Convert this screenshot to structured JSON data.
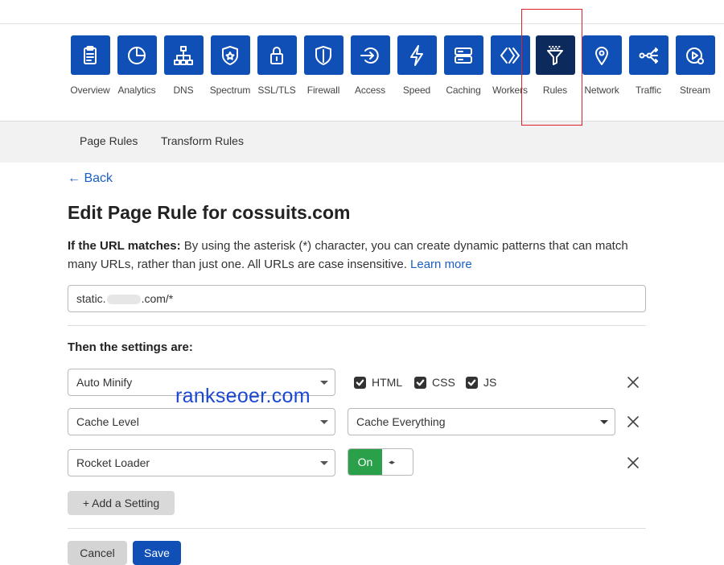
{
  "nav": {
    "items": [
      {
        "label": "Overview",
        "icon": "clipboard-icon"
      },
      {
        "label": "Analytics",
        "icon": "pie-chart-icon"
      },
      {
        "label": "DNS",
        "icon": "network-tree-icon"
      },
      {
        "label": "Spectrum",
        "icon": "shield-star-icon"
      },
      {
        "label": "SSL/TLS",
        "icon": "lock-icon"
      },
      {
        "label": "Firewall",
        "icon": "firewall-shield-icon"
      },
      {
        "label": "Access",
        "icon": "access-arrow-icon"
      },
      {
        "label": "Speed",
        "icon": "lightning-icon"
      },
      {
        "label": "Caching",
        "icon": "server-stack-icon"
      },
      {
        "label": "Workers",
        "icon": "code-brackets-icon"
      },
      {
        "label": "Rules",
        "icon": "filter-funnel-icon",
        "active": true
      },
      {
        "label": "Network",
        "icon": "location-pin-icon"
      },
      {
        "label": "Traffic",
        "icon": "traffic-flow-icon"
      },
      {
        "label": "Stream",
        "icon": "stream-play-icon"
      }
    ]
  },
  "subnav": {
    "page_rules": "Page Rules",
    "transform_rules": "Transform Rules"
  },
  "back_link": "← Back",
  "page_title": "Edit Page Rule for cossuits.com",
  "description": {
    "bold": "If the URL matches:",
    "text": " By using the asterisk (*) character, you can create dynamic patterns that can match many URLs, rather than just one. All URLs are case insensitive. ",
    "link": "Learn more"
  },
  "url_input": {
    "prefix": "static.",
    "suffix": ".com/*"
  },
  "settings_title": "Then the settings are:",
  "settings": {
    "row1": {
      "select": "Auto Minify",
      "checkboxes": [
        "HTML",
        "CSS",
        "JS"
      ]
    },
    "row2": {
      "select": "Cache Level",
      "value": "Cache Everything"
    },
    "row3": {
      "select": "Rocket Loader",
      "toggle": "On",
      "toggle_handle": "◂▸"
    }
  },
  "watermark": "rankseoer.com",
  "buttons": {
    "add_setting": "+ Add a Setting",
    "cancel": "Cancel",
    "save": "Save"
  },
  "colors": {
    "brand": "#0f4fb6",
    "active_nav": "#0c2a5b",
    "link": "#1c5fc4",
    "toggle_on": "#2aa04a",
    "highlight": "#e0202a"
  }
}
